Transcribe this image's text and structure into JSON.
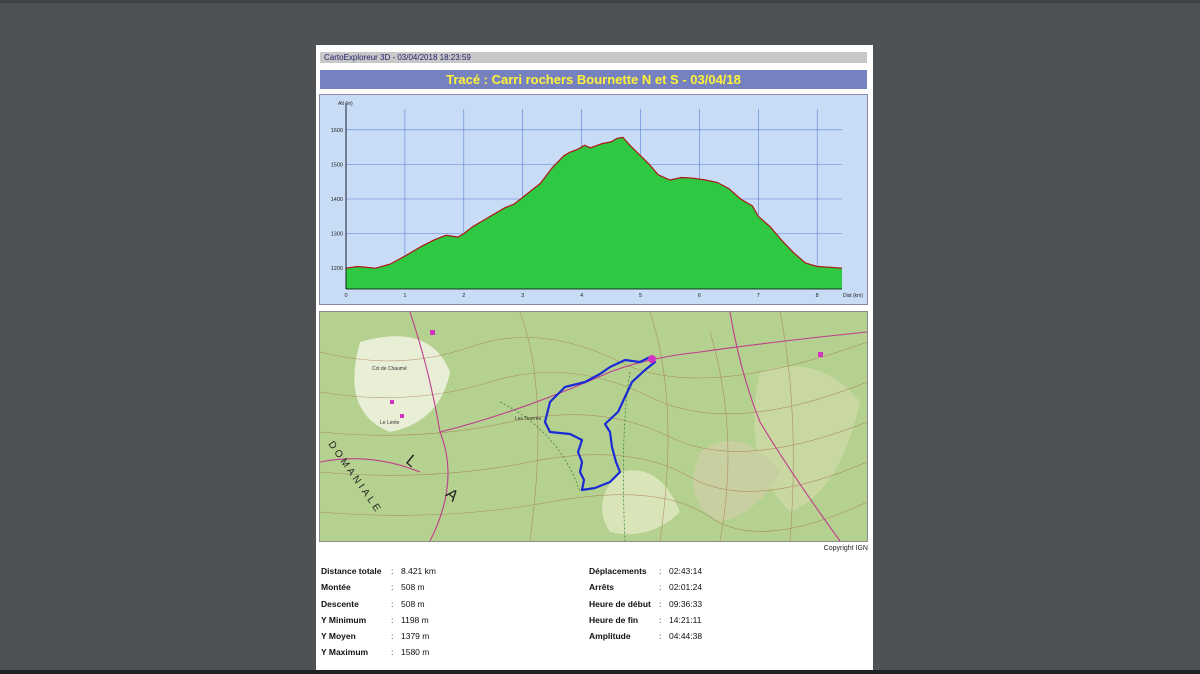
{
  "app_header": "CartoExploreur 3D - 03/04/2018 18:23:59",
  "title": "Tracé : Carri rochers Bournette N et S - 03/04/18",
  "chart_data": {
    "type": "area",
    "ylabel": "Alt (m)",
    "xlabel": "Dist (km)",
    "ylim": [
      1140,
      1660
    ],
    "xlim": [
      0,
      8.421
    ],
    "y_ticks": [
      1200,
      1300,
      1400,
      1500,
      1600
    ],
    "x_ticks": [
      0,
      1,
      2,
      3,
      4,
      5,
      6,
      7,
      8
    ],
    "grid": true,
    "fill_color": "#2ec842",
    "line_color": "#b01515",
    "background": "#c9dcf6",
    "x": [
      0,
      0.2,
      0.5,
      0.75,
      1.0,
      1.3,
      1.5,
      1.7,
      1.9,
      2.0,
      2.15,
      2.4,
      2.7,
      2.85,
      3.0,
      3.15,
      3.3,
      3.5,
      3.7,
      3.8,
      3.95,
      4.05,
      4.15,
      4.35,
      4.5,
      4.6,
      4.7,
      4.85,
      5.0,
      5.15,
      5.3,
      5.5,
      5.7,
      5.9,
      6.1,
      6.3,
      6.5,
      6.7,
      6.9,
      7.0,
      7.2,
      7.4,
      7.6,
      7.8,
      8.0,
      8.2,
      8.421
    ],
    "y": [
      1200,
      1205,
      1200,
      1212,
      1235,
      1265,
      1282,
      1295,
      1290,
      1300,
      1320,
      1345,
      1375,
      1385,
      1405,
      1425,
      1445,
      1490,
      1525,
      1535,
      1545,
      1555,
      1548,
      1560,
      1565,
      1575,
      1578,
      1550,
      1525,
      1500,
      1470,
      1455,
      1462,
      1460,
      1455,
      1448,
      1430,
      1400,
      1380,
      1350,
      1320,
      1280,
      1245,
      1215,
      1205,
      1203,
      1200
    ]
  },
  "map": {
    "copyright": "Copyright IGN",
    "labels": [
      "Col de Chaumé",
      "Les Tourrès",
      "Le Lente"
    ],
    "side_text": "DOMANIALE",
    "side_letters": "L A"
  },
  "stats_left": [
    {
      "label": "Distance totale",
      "value": "8.421 km"
    },
    {
      "label": "Montée",
      "value": "508 m"
    },
    {
      "label": "Descente",
      "value": "508 m"
    },
    {
      "label": "Y Minimum",
      "value": "1198 m"
    },
    {
      "label": "Y Moyen",
      "value": "1379 m"
    },
    {
      "label": "Y Maximum",
      "value": "1580 m"
    }
  ],
  "stats_right": [
    {
      "label": "Déplacements",
      "value": "02:43:14"
    },
    {
      "label": "Arrêts",
      "value": "02:01:24"
    },
    {
      "label": "Heure de début",
      "value": "09:36:33"
    },
    {
      "label": "Heure de fin",
      "value": "14:21:11"
    },
    {
      "label": "Amplitude",
      "value": "04:44:38"
    }
  ],
  "colon": ":"
}
